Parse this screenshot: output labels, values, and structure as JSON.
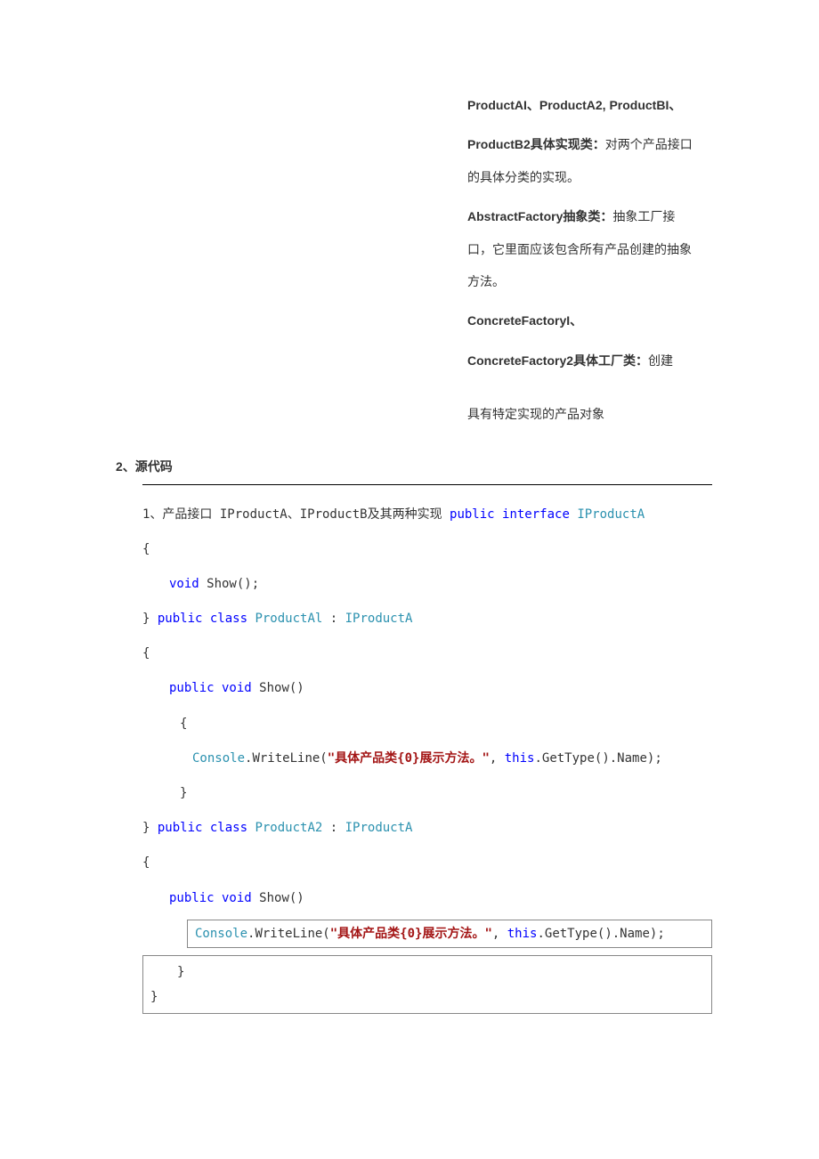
{
  "right_col": {
    "p1_bold": "ProductAI、ProductA2, ProductBI、",
    "p2_bold": "ProductB2具体实现类：",
    "p2_rest": "对两个产品接口的具体分类的实现。",
    "p3_bold": "AbstractFactory抽象类：",
    "p3_rest": "抽象工厂接口，它里面应该包含所有产品创建的抽象方法。",
    "p4_bold": "ConcreteFactoryI、",
    "p5_bold": "ConcreteFactory2具体工厂类：",
    "p5_rest": "创建",
    "p6": "具有特定实现的产品对象"
  },
  "heading": "2、源代码",
  "code": {
    "l1a": "1、产品接口 IProductA、IProductB及其两种实现 ",
    "l1_public": "public",
    "l1_interface": " interface",
    "l1_type": " IProductA",
    "l2": "{",
    "l3_void": "void",
    "l3_rest": " Show();",
    "l4a": "} ",
    "l4_public": "public",
    "l4_class": " class",
    "l4_type1": " ProductAl",
    "l4_colon": " : ",
    "l4_type2": "IProductA",
    "l5": "{",
    "l6_pub": "public",
    "l6_void": " void",
    "l6_rest": " Show()",
    "l7": "{",
    "l8_console": "Console",
    "l8_mid1": ".WriteLine(",
    "l8_str": "\"具体产品类{0}展示方法。\"",
    "l8_mid2": ", ",
    "l8_this": "this",
    "l8_end": ".GetType().Name);",
    "l9": "}",
    "l10a": "} ",
    "l10_public": "public",
    "l10_class": " class",
    "l10_type1": " ProductA2",
    "l10_colon": " : ",
    "l10_type2": "IProductA",
    "l11": "{",
    "l12_pub": "public",
    "l12_void": " void",
    "l12_rest": " Show()"
  },
  "box1": {
    "console": "Console",
    "mid1": ".WriteLine(",
    "str": "\"具体产品类{0}展示方法。\"",
    "mid2": ", ",
    "this": "this",
    "end": ".GetType().Name);"
  },
  "box2": {
    "l1": "}",
    "l2": "}"
  }
}
